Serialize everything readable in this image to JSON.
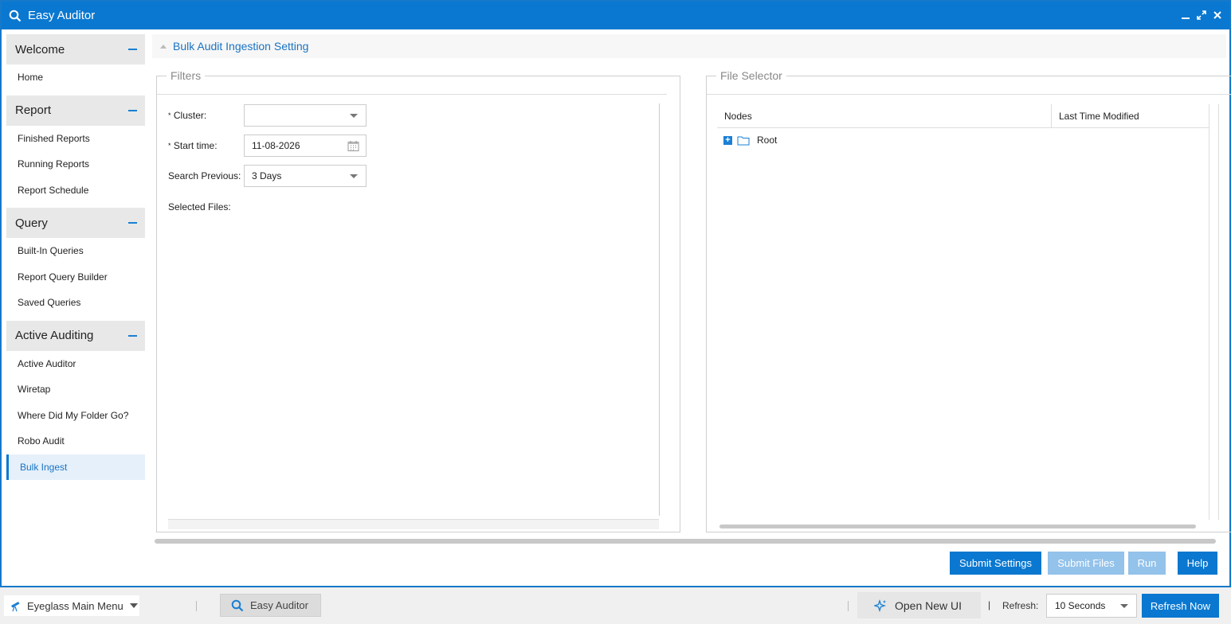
{
  "window": {
    "title": "Easy Auditor",
    "title_icon": "search-icon",
    "controls": [
      "minimize-icon",
      "restore-icon",
      "close-icon"
    ]
  },
  "sidebar": {
    "sections": [
      {
        "title": "Welcome",
        "items": [
          {
            "label": "Home"
          }
        ]
      },
      {
        "title": "Report",
        "items": [
          {
            "label": "Finished Reports"
          },
          {
            "label": "Running Reports"
          },
          {
            "label": "Report Schedule"
          }
        ]
      },
      {
        "title": "Query",
        "items": [
          {
            "label": "Built-In Queries"
          },
          {
            "label": "Report Query Builder"
          },
          {
            "label": "Saved Queries"
          }
        ]
      },
      {
        "title": "Active Auditing",
        "items": [
          {
            "label": "Active Auditor"
          },
          {
            "label": "Wiretap"
          },
          {
            "label": "Where Did My Folder Go?"
          },
          {
            "label": "Robo Audit"
          },
          {
            "label": "Bulk Ingest"
          }
        ]
      }
    ],
    "active_item": "Bulk Ingest"
  },
  "content": {
    "title": "Bulk Audit Ingestion Setting",
    "filters": {
      "legend": "Filters",
      "cluster": {
        "label": "Cluster:",
        "value": ""
      },
      "start_time": {
        "label": "Start time:",
        "value": "11-08-2026"
      },
      "search_previous": {
        "label": "Search Previous:",
        "value": "3 Days"
      },
      "selected_files": {
        "label": "Selected Files:"
      },
      "required_marker": "*"
    },
    "file_selector": {
      "legend": "File Selector",
      "columns": [
        "Nodes",
        "Last Time Modified"
      ],
      "rows": [
        {
          "label": "Root",
          "expand": "+"
        }
      ]
    },
    "buttons": {
      "submit_settings": "Submit Settings",
      "submit_files": "Submit Files",
      "run": "Run",
      "help": "Help"
    }
  },
  "taskbar": {
    "main_menu": "Eyeglass Main Menu",
    "task": "Easy Auditor",
    "open_new_ui": "Open New UI",
    "pipe": "|",
    "refresh_label": "Refresh:",
    "refresh_interval": "10 Seconds",
    "refresh_now": "Refresh Now"
  },
  "colors": {
    "accent": "#0a78d0",
    "disabled": "#93c2ea",
    "link": "#1a73c2"
  }
}
